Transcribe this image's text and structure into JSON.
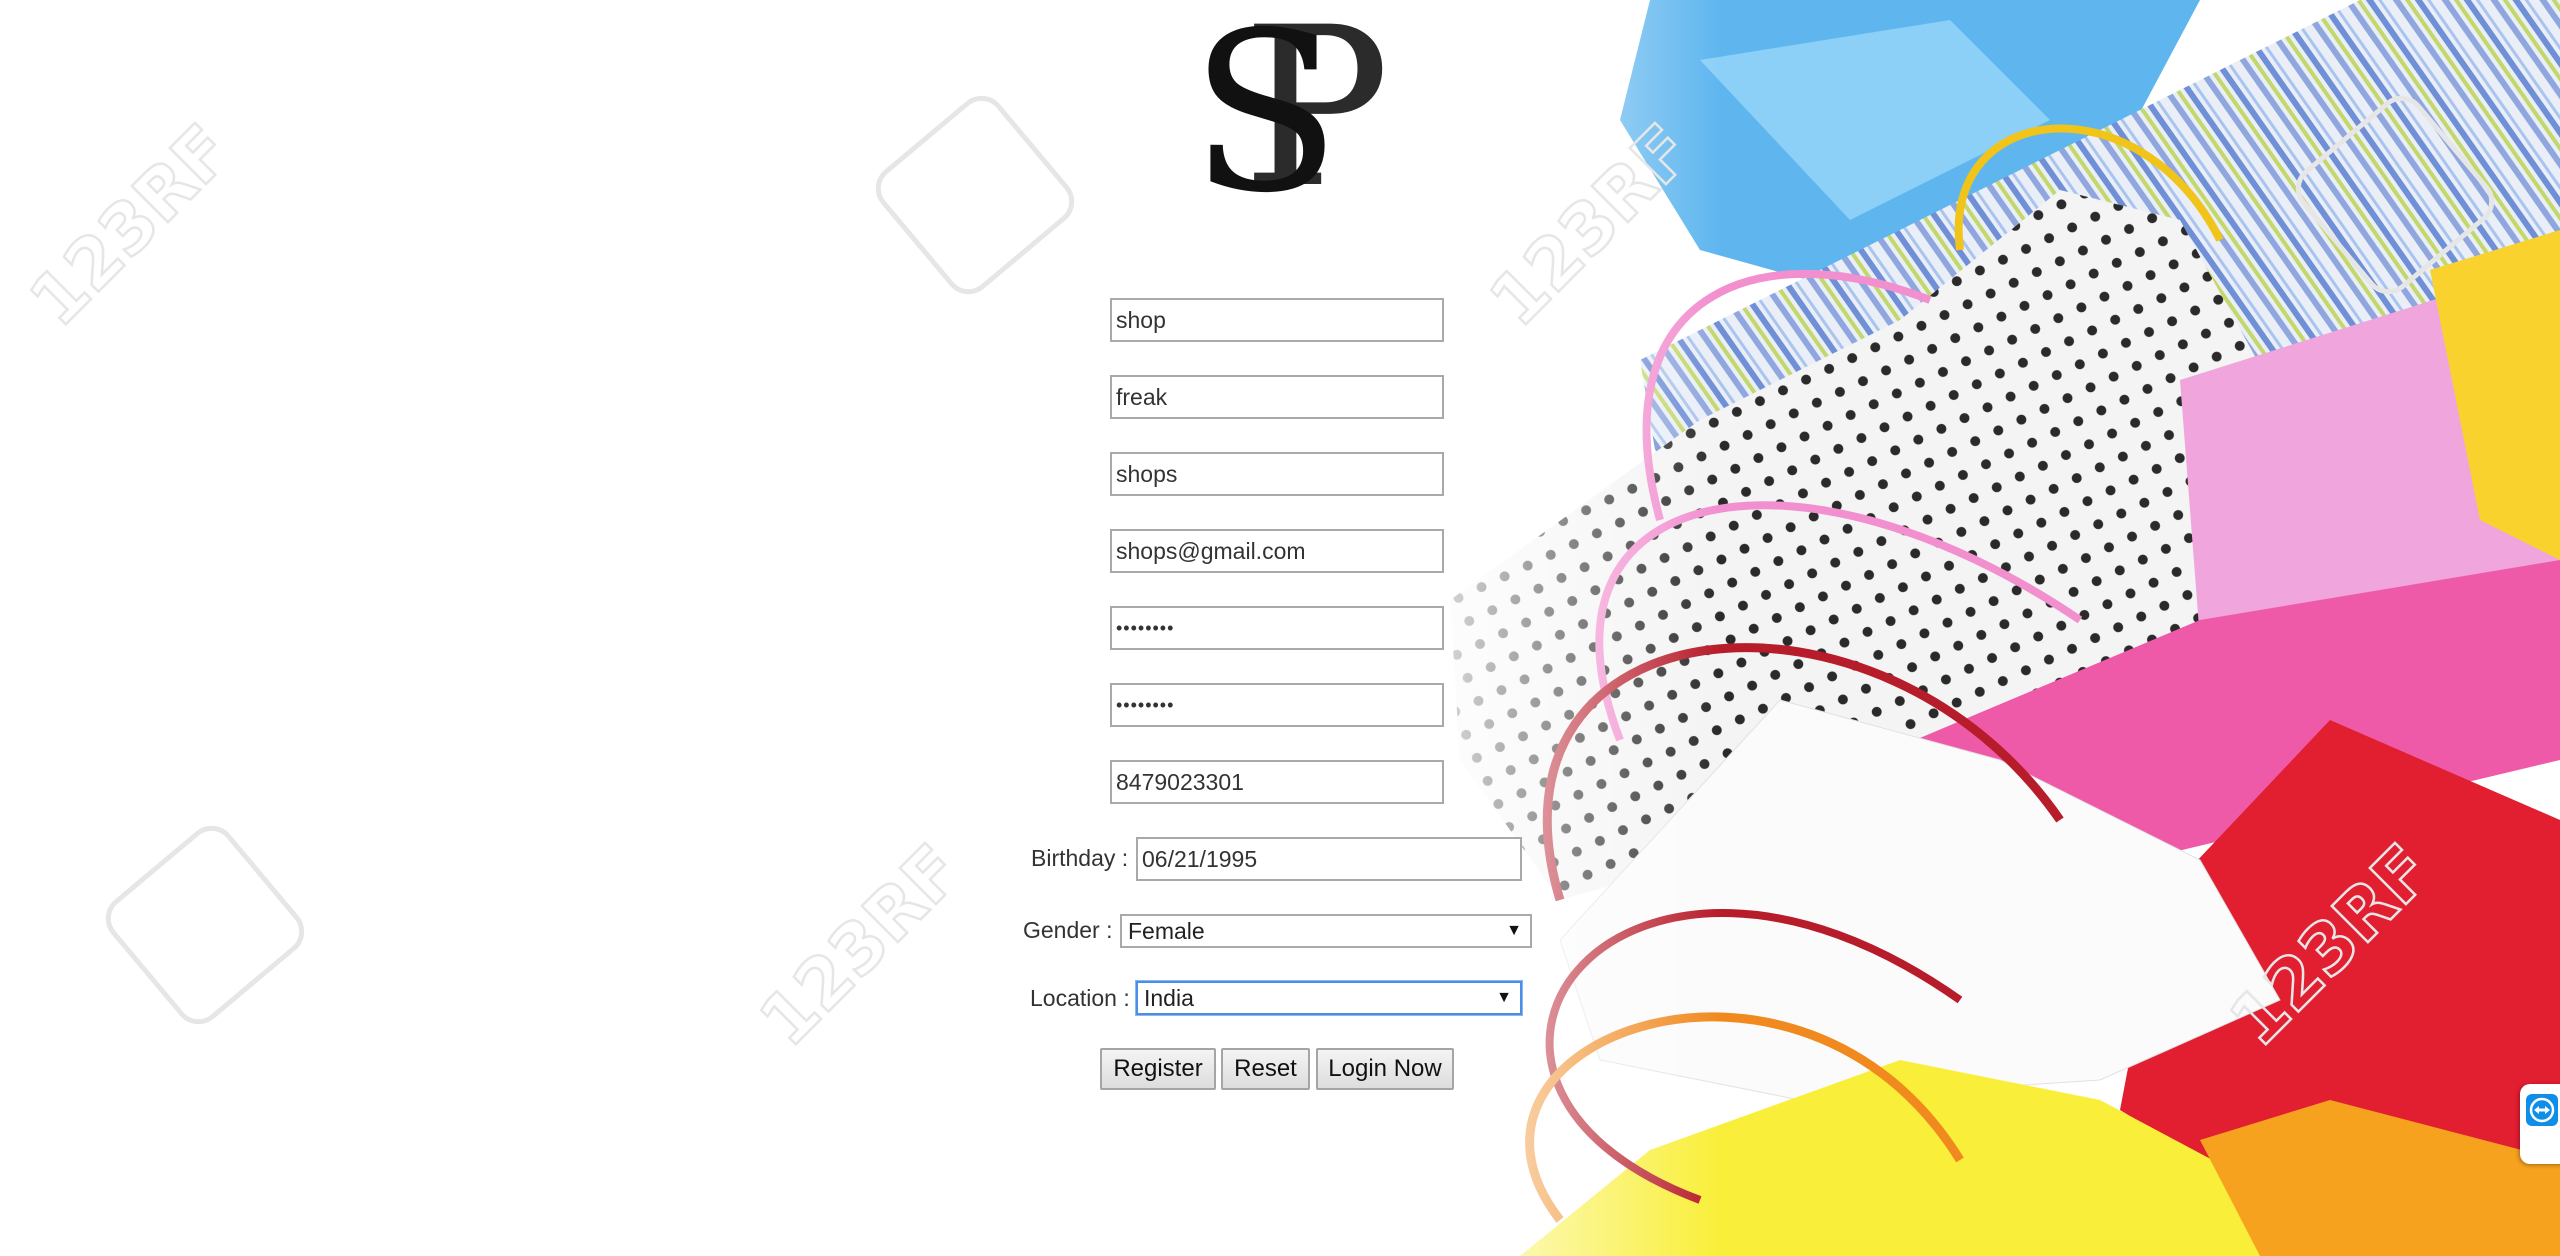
{
  "logo": {
    "letter_1": "S",
    "letter_2": "P"
  },
  "form": {
    "first_name": "shop",
    "last_name": "freak",
    "username": "shops",
    "email": "shops@gmail.com",
    "password": "••••••••",
    "confirm_password": "••••••••",
    "phone": "8479023301",
    "birthday_label": "Birthday :",
    "birthday": "06/21/1995",
    "gender_label": "Gender :",
    "gender": "Female",
    "location_label": "Location :",
    "location": "India"
  },
  "buttons": {
    "register": "Register",
    "reset": "Reset",
    "login_now": "Login Now"
  },
  "watermark": "123RF",
  "icons": {
    "dropdown": "chevron-down-icon",
    "teamviewer": "teamviewer-icon"
  },
  "colors": {
    "focus_border": "#4a8ee8",
    "teamviewer_blue": "#0e8ee9"
  }
}
